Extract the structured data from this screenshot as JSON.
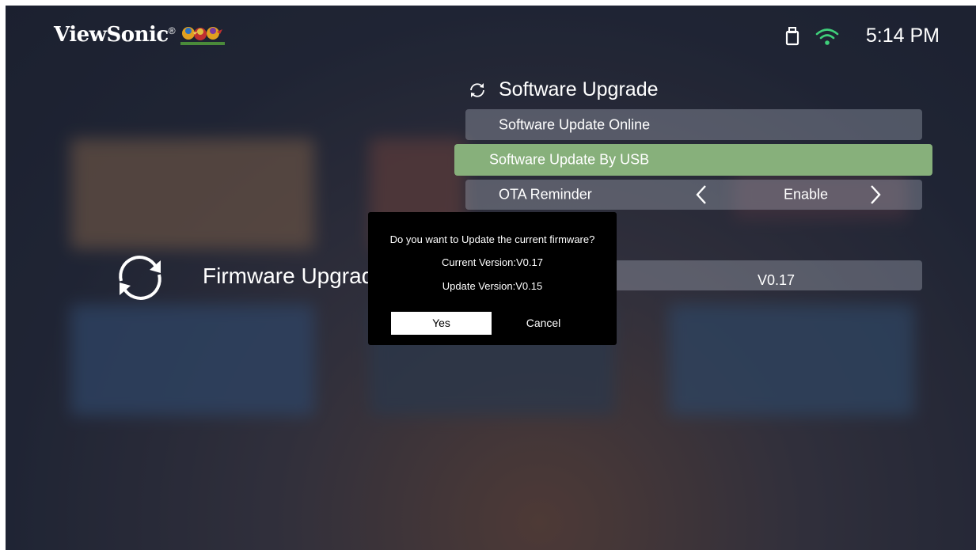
{
  "header": {
    "brand": "ViewSonic",
    "brand_mark": "®",
    "time": "5:14 PM",
    "icons": [
      "usb-icon",
      "wifi-icon"
    ]
  },
  "firmware": {
    "title": "Firmware Upgrade",
    "icon": "sync-icon"
  },
  "software_panel": {
    "title": "Software Upgrade",
    "title_icon": "refresh-icon",
    "items": [
      {
        "label": "Software Update Online"
      },
      {
        "label": "Software Update By USB",
        "selected": true
      },
      {
        "label": "OTA Reminder",
        "value": "Enable"
      }
    ],
    "version_value": "V0.17"
  },
  "dialog": {
    "question": "Do you want to Update the current firmware?",
    "current_version": "Current Version:V0.17",
    "update_version": "Update Version:V0.15",
    "yes_label": "Yes",
    "cancel_label": "Cancel"
  },
  "colors": {
    "selected_row": "#87b07b",
    "dialog_bg": "#000000",
    "text": "#ffffff"
  }
}
